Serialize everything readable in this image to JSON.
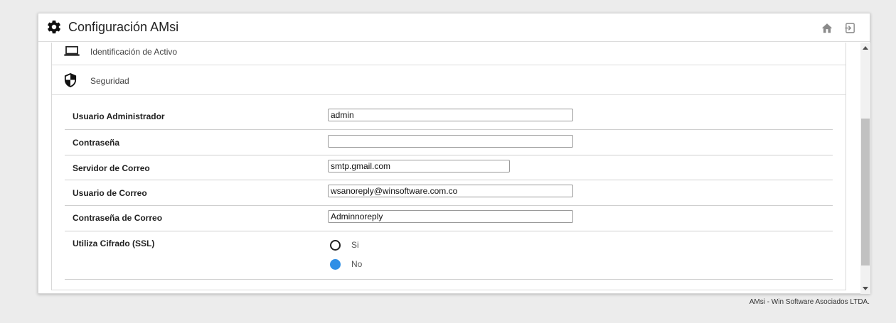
{
  "header": {
    "title": "Configuración AMsi",
    "icons": [
      "gear-icon",
      "home-icon",
      "exit-icon"
    ]
  },
  "sections": [
    {
      "label": "Identificación de Activo",
      "icon": "laptop-icon"
    },
    {
      "label": "Seguridad",
      "icon": "shield-icon"
    }
  ],
  "form": {
    "admin_user": {
      "label": "Usuario Administrador",
      "value": "admin"
    },
    "password": {
      "label": "Contraseña",
      "value": ""
    },
    "mail_server": {
      "label": "Servidor de Correo",
      "value": "smtp.gmail.com"
    },
    "mail_user": {
      "label": "Usuario de Correo",
      "value": "wsanoreply@winsoftware.com.co"
    },
    "mail_password": {
      "label": "Contraseña de Correo",
      "value": "Adminnoreply"
    },
    "ssl": {
      "label": "Utiliza Cifrado (SSL)",
      "options": [
        {
          "label": "Si",
          "selected": false
        },
        {
          "label": "No",
          "selected": true
        }
      ]
    }
  },
  "colors": {
    "accent": "#2f8fe6",
    "background": "#ececec"
  },
  "footer": {
    "text": "AMsi - Win Software Asociados LTDA."
  }
}
